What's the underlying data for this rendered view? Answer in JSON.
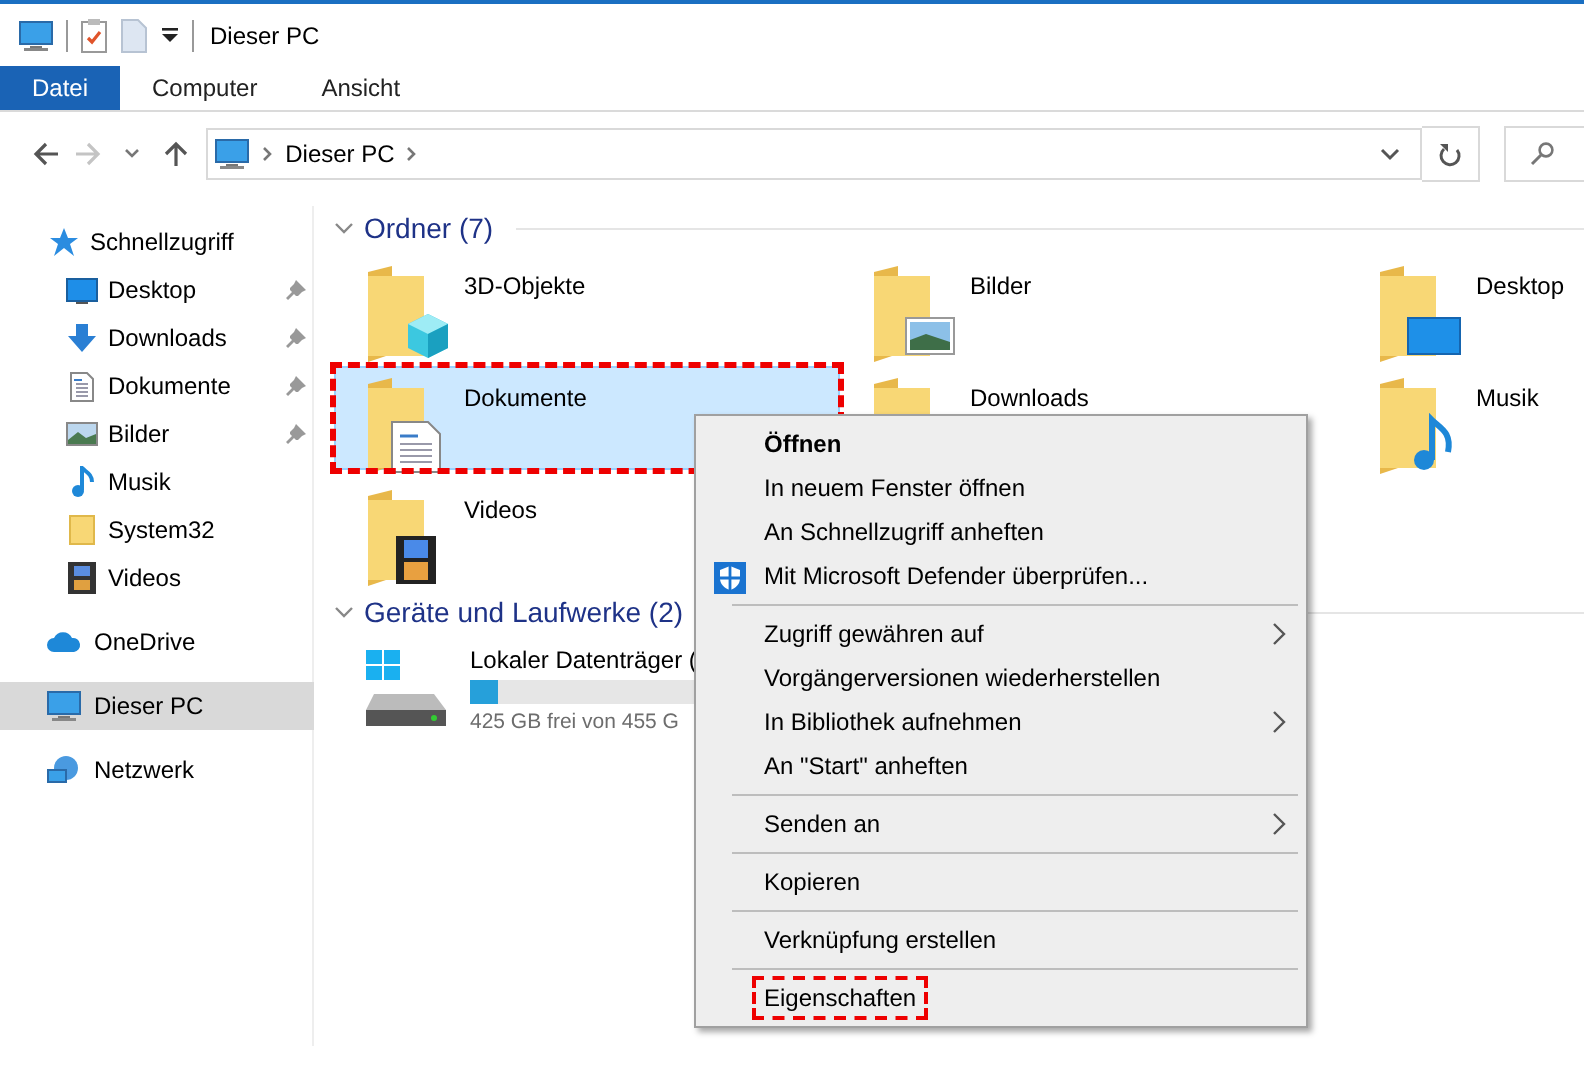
{
  "title_bar": {
    "title": "Dieser PC"
  },
  "ribbon_tabs": [
    {
      "label": "Datei",
      "selected": true
    },
    {
      "label": "Computer",
      "selected": false
    },
    {
      "label": "Ansicht",
      "selected": false
    }
  ],
  "navigation": {
    "back": {
      "disabled": false
    },
    "forward": {
      "disabled": true
    }
  },
  "address_bar": {
    "path": [
      "Dieser PC"
    ]
  },
  "sidebar": {
    "items": [
      {
        "label": "Schnellzugriff",
        "selected": false,
        "children": [
          {
            "label": "Desktop",
            "selected": false,
            "pinned": true
          },
          {
            "label": "Downloads",
            "selected": false,
            "pinned": true
          },
          {
            "label": "Dokumente",
            "selected": false,
            "pinned": true
          },
          {
            "label": "Bilder",
            "selected": false,
            "pinned": true
          },
          {
            "label": "Musik",
            "selected": false,
            "pinned": false
          },
          {
            "label": "System32",
            "selected": false,
            "pinned": false
          },
          {
            "label": "Videos",
            "selected": false,
            "pinned": false
          }
        ]
      },
      {
        "label": "OneDrive",
        "selected": false
      },
      {
        "label": "Dieser PC",
        "selected": true
      },
      {
        "label": "Netzwerk",
        "selected": false
      }
    ]
  },
  "folders": {
    "title": "Ordner (7)",
    "expanded": true,
    "items": [
      {
        "name": "3D-Objekte",
        "selected": false,
        "highlighted": false
      },
      {
        "name": "Bilder",
        "selected": false,
        "highlighted": false
      },
      {
        "name": "Desktop",
        "selected": false,
        "highlighted": false
      },
      {
        "name": "Dokumente",
        "selected": true,
        "highlighted": true
      },
      {
        "name": "Downloads",
        "selected": false,
        "highlighted": false
      },
      {
        "name": "Musik",
        "selected": false,
        "highlighted": false
      },
      {
        "name": "Videos",
        "selected": false,
        "highlighted": false
      }
    ]
  },
  "drives": {
    "title": "Geräte und Laufwerke (2)",
    "expanded": true,
    "items": [
      {
        "name": "Lokaler Datenträger (",
        "level": 0.07,
        "free_space": "425 GB frei von 455 G"
      }
    ]
  },
  "context_menu": {
    "groups": [
      {
        "items": [
          {
            "label": "Öffnen",
            "default": true,
            "submenu": false,
            "has_icon": false,
            "highlighted": false
          },
          {
            "label": "In neuem Fenster öffnen",
            "default": false,
            "submenu": false,
            "has_icon": false,
            "highlighted": false
          },
          {
            "label": "An Schnellzugriff anheften",
            "default": false,
            "submenu": false,
            "has_icon": false,
            "highlighted": false
          },
          {
            "label": "Mit Microsoft Defender überprüfen...",
            "default": false,
            "submenu": false,
            "has_icon": true,
            "highlighted": false
          }
        ]
      },
      {
        "items": [
          {
            "label": "Zugriff gewähren auf",
            "default": false,
            "submenu": true,
            "has_icon": false,
            "highlighted": false
          },
          {
            "label": "Vorgängerversionen wiederherstellen",
            "default": false,
            "submenu": false,
            "has_icon": false,
            "highlighted": false
          },
          {
            "label": "In Bibliothek aufnehmen",
            "default": false,
            "submenu": true,
            "has_icon": false,
            "highlighted": false
          },
          {
            "label": "An \"Start\" anheften",
            "default": false,
            "submenu": false,
            "has_icon": false,
            "highlighted": false
          }
        ]
      },
      {
        "items": [
          {
            "label": "Senden an",
            "default": false,
            "submenu": true,
            "has_icon": false,
            "highlighted": false
          }
        ]
      },
      {
        "items": [
          {
            "label": "Kopieren",
            "default": false,
            "submenu": false,
            "has_icon": false,
            "highlighted": false
          }
        ]
      },
      {
        "items": [
          {
            "label": "Verknüpfung erstellen",
            "default": false,
            "submenu": false,
            "has_icon": false,
            "highlighted": false
          }
        ]
      },
      {
        "items": [
          {
            "label": "Eigenschaften",
            "default": false,
            "submenu": false,
            "has_icon": false,
            "highlighted": true
          }
        ]
      }
    ]
  }
}
